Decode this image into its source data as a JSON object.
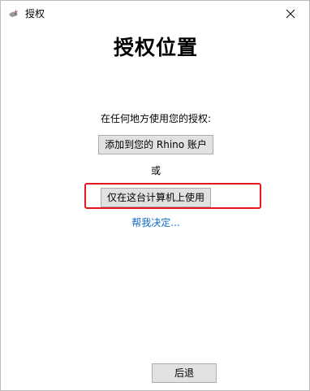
{
  "window": {
    "title": "授权",
    "close_glyph": "✕",
    "app_icon": "rhino-app-icon"
  },
  "main": {
    "heading": "授权位置",
    "instruction": "在任何地方使用您的授权:",
    "add_account_label": "添加到您的 Rhino 账户",
    "or_label": "或",
    "local_only_label": "仅在这台计算机上使用",
    "help_link": "帮我决定..."
  },
  "footer": {
    "back_label": "后退"
  },
  "colors": {
    "highlight": "#e5181e",
    "link": "#0b6bc8",
    "button_bg": "#e1e1e1"
  }
}
